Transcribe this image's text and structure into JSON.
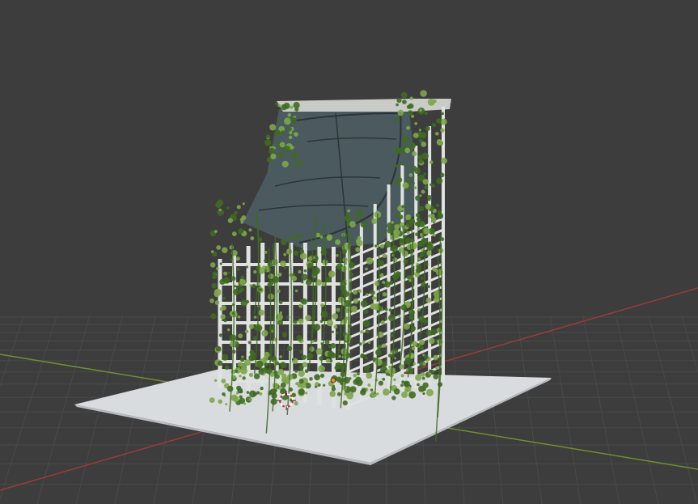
{
  "app": {
    "name": "3D Viewport"
  },
  "viewport": {
    "background_color": "#3d3d3d",
    "grid_line_color": "#4a4a4a",
    "x_axis_color": "#9a3b3b",
    "y_axis_color": "#6f8f2f",
    "ground_plane_color": "#d9dcdf",
    "building_frame_color": "#dfe2df",
    "building_inner_color": "#4a5a5e",
    "ivy_color_dark": "#3f6a22",
    "ivy_color_light": "#7da64a"
  },
  "scene": {
    "objects": [
      {
        "name": "ground-plane",
        "type": "plane"
      },
      {
        "name": "ruined-building",
        "type": "mesh"
      },
      {
        "name": "ivy-growth",
        "type": "particles"
      },
      {
        "name": "3d-cursor",
        "type": "cursor"
      },
      {
        "name": "origin-point",
        "type": "origin"
      }
    ]
  }
}
